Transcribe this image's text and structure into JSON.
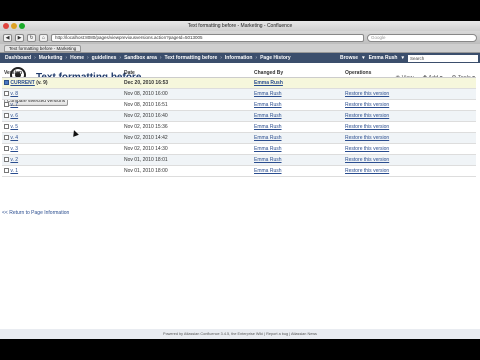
{
  "window": {
    "title": "Text formatting before - Marketing - Confluence"
  },
  "browser": {
    "url": "http://localhost:8080/pages/viewpreviousversions.action?pageId=5013005",
    "search_placeholder": "Google",
    "tab_label": "Text formatting before - Marketing"
  },
  "nav": {
    "crumbs": [
      "Dashboard",
      "Marketing",
      "Home",
      "guidelines",
      "Sandbox area",
      "Text formatting before",
      "Information",
      "Page History"
    ],
    "browse": "Browse",
    "user": "Emma Rush",
    "search_placeholder": "Search"
  },
  "header": {
    "logo_text": "University of Life",
    "page_title": "Text formatting before",
    "view": "View",
    "add": "Add",
    "tools": "Tools"
  },
  "compare_button": "Compare selected versions",
  "table": {
    "headers": [
      "Version",
      "Date",
      "Changed By",
      "Operations"
    ],
    "rows": [
      {
        "version": "CURRENT",
        "suffix": " (v. 9)",
        "date": "Dec 20, 2010 16:53",
        "by": "Emma Rush",
        "op": "",
        "checked": true
      },
      {
        "version": "v. 8",
        "suffix": "",
        "date": "Nov 08, 2010 16:00",
        "by": "Emma Rush",
        "op": "Restore this version",
        "checked": false
      },
      {
        "version": "v. 7",
        "suffix": "",
        "date": "Nov 08, 2010 16:51",
        "by": "Emma Rush",
        "op": "Restore this version",
        "checked": false
      },
      {
        "version": "v. 6",
        "suffix": "",
        "date": "Nov 02, 2010 16:40",
        "by": "Emma Rush",
        "op": "Restore this version",
        "checked": false
      },
      {
        "version": "v. 5",
        "suffix": "",
        "date": "Nov 02, 2010 15:36",
        "by": "Emma Rush",
        "op": "Restore this version",
        "checked": false
      },
      {
        "version": "v. 4",
        "suffix": "",
        "date": "Nov 02, 2010 14:42",
        "by": "Emma Rush",
        "op": "Restore this version",
        "checked": false
      },
      {
        "version": "v. 3",
        "suffix": "",
        "date": "Nov 02, 2010 14:30",
        "by": "Emma Rush",
        "op": "Restore this version",
        "checked": false
      },
      {
        "version": "v. 2",
        "suffix": "",
        "date": "Nov 01, 2010 18:01",
        "by": "Emma Rush",
        "op": "Restore this version",
        "checked": false
      },
      {
        "version": "v. 1",
        "suffix": "",
        "date": "Nov 01, 2010 18:00",
        "by": "Emma Rush",
        "op": "Restore this version",
        "checked": false
      }
    ]
  },
  "back_link": "<< Return to Page Information",
  "footer": "Powered by Atlassian Confluence 3.4.5, the Enterprise Wiki  |  Report a bug  |  Atlassian News"
}
